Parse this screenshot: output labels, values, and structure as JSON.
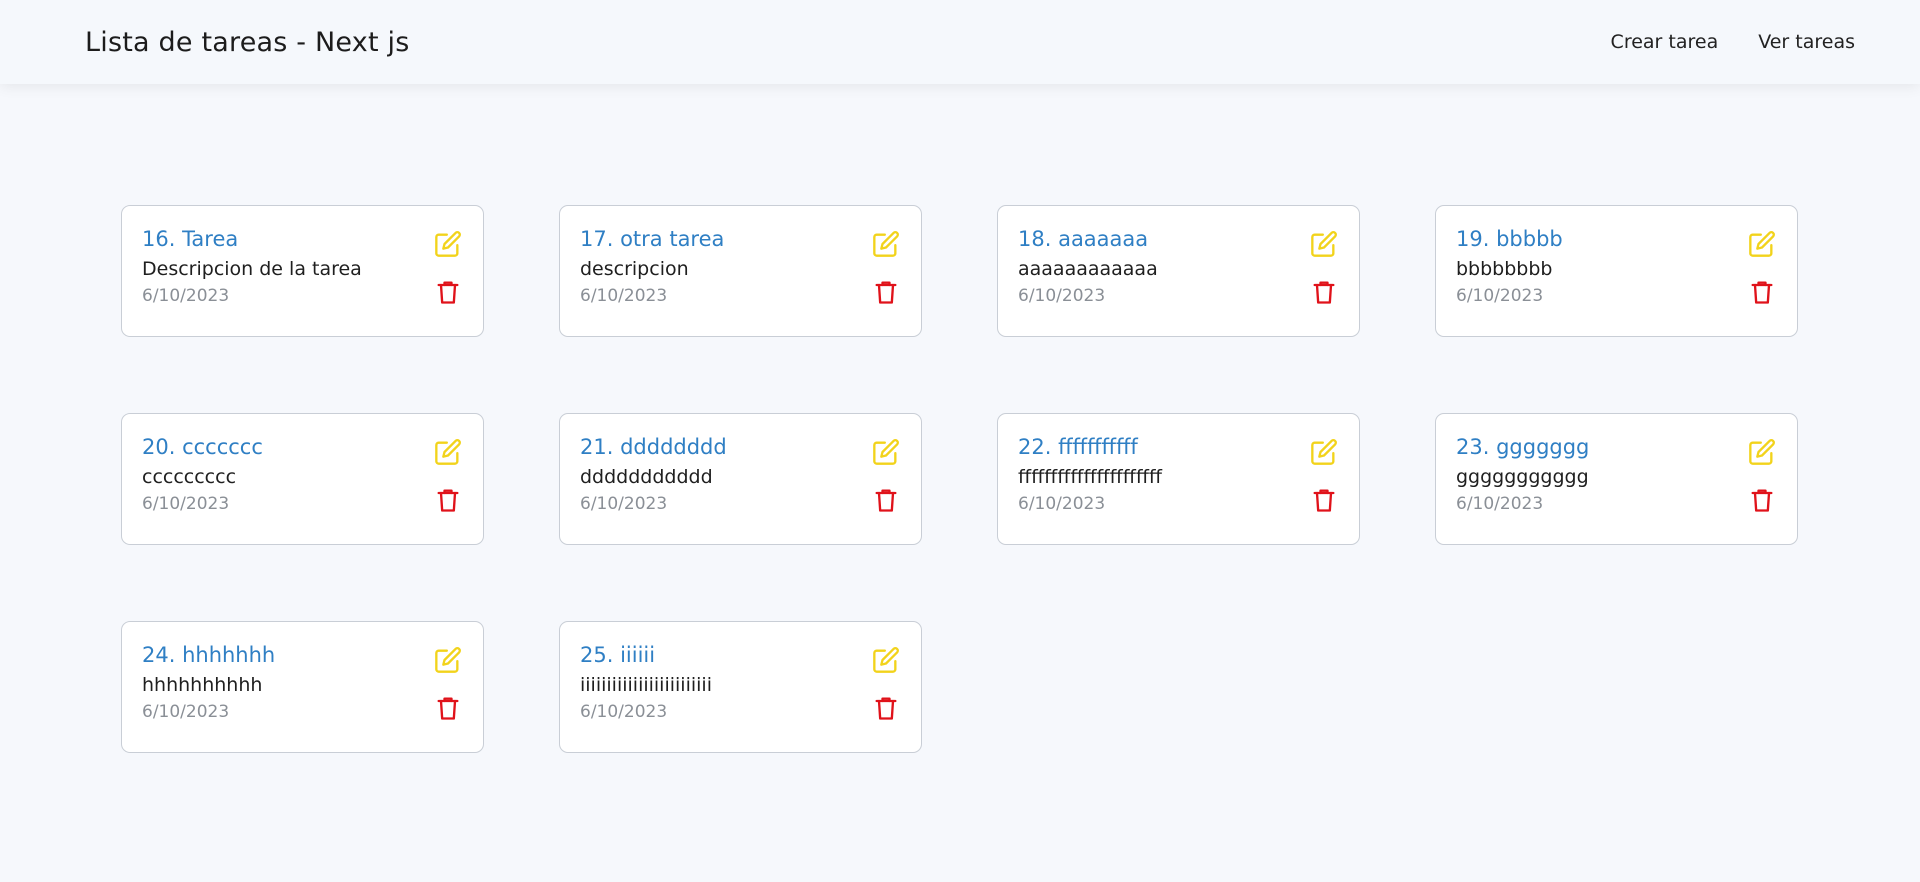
{
  "header": {
    "title": "Lista de tareas - Next js",
    "links": [
      {
        "label": "Crear tarea"
      },
      {
        "label": "Ver tareas"
      }
    ]
  },
  "colors": {
    "title": "#2f7fc4",
    "edit_icon": "#f2d31b",
    "delete_icon": "#e0121a"
  },
  "icons": {
    "edit": "edit-icon",
    "delete": "trash-icon"
  },
  "tasks": [
    {
      "title": "16. Tarea",
      "description": "Descripcion de la tarea",
      "date": "6/10/2023"
    },
    {
      "title": "17. otra tarea",
      "description": "descripcion",
      "date": "6/10/2023"
    },
    {
      "title": "18. aaaaaaa",
      "description": "aaaaaaaaaaaa",
      "date": "6/10/2023"
    },
    {
      "title": "19. bbbbb",
      "description": "bbbbbbbb",
      "date": "6/10/2023"
    },
    {
      "title": "20. ccccccc",
      "description": "ccccccccc",
      "date": "6/10/2023"
    },
    {
      "title": "21. dddddddd",
      "description": "ddddddddddd",
      "date": "6/10/2023"
    },
    {
      "title": "22. fffffffffff",
      "description": "ffffffffffffffffffffff",
      "date": "6/10/2023"
    },
    {
      "title": "23. ggggggg",
      "description": "ggggggggggg",
      "date": "6/10/2023"
    },
    {
      "title": "24. hhhhhhh",
      "description": "hhhhhhhhhh",
      "date": "6/10/2023"
    },
    {
      "title": "25. iiiiii",
      "description": "iiiiiiiiiiiiiiiiiiiiiiiii",
      "date": "6/10/2023"
    }
  ]
}
